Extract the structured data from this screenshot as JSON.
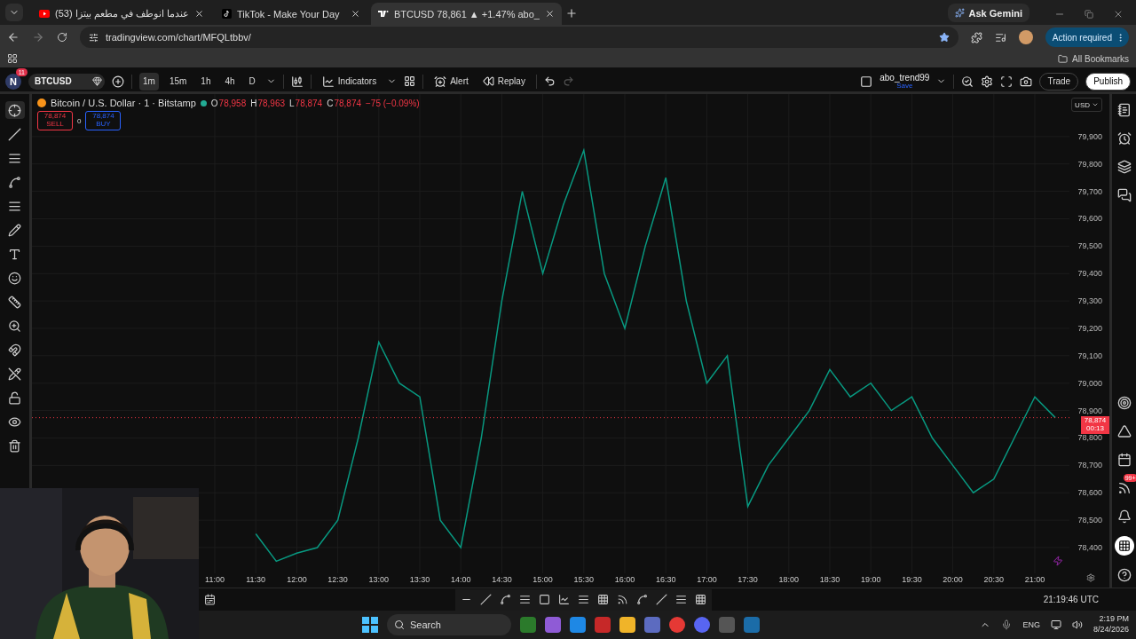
{
  "browser": {
    "tabs": [
      {
        "title": "عندما انوطف في مطعم بيتزا (53)",
        "kind": "video",
        "selected": false
      },
      {
        "title": "TikTok - Make Your Day",
        "kind": "music",
        "selected": false
      },
      {
        "title": "BTCUSD 78,861 ▲ +1.47% abo_",
        "kind": "chart",
        "selected": true
      }
    ],
    "ask_gemini": "Ask Gemini",
    "url": "tradingview.com/chart/MFQLtbbv/",
    "action_required": "Action required",
    "bookmarks": "All Bookmarks"
  },
  "toolbar": {
    "avatar": "N",
    "avatar_badge": "11",
    "symbol": "BTCUSD",
    "intervals": [
      {
        "label": "1m",
        "selected": true
      },
      {
        "label": "15m",
        "selected": false
      },
      {
        "label": "1h",
        "selected": false
      },
      {
        "label": "4h",
        "selected": false
      },
      {
        "label": "D",
        "selected": false
      }
    ],
    "indicators": "Indicators",
    "alert": "Alert",
    "replay": "Replay",
    "layout_name": "abo_trend99",
    "save": "Save",
    "trade": "Trade",
    "publish": "Publish"
  },
  "legend": {
    "title": "Bitcoin / U.S. Dollar · 1 · Bitstamp",
    "ohlc": [
      {
        "label": "O",
        "value": "78,958"
      },
      {
        "label": "H",
        "value": "78,963"
      },
      {
        "label": "L",
        "value": "78,874"
      },
      {
        "label": "C",
        "value": "78,874"
      }
    ],
    "change": "−75 (−0.09%)",
    "sell_price": "78,874",
    "sell": "SELL",
    "spread": "0",
    "buy_price": "78,874",
    "buy": "BUY"
  },
  "chart": {
    "currency": "USD",
    "price_tag": "78,874",
    "countdown": "00:13",
    "clock": "21:19:46 UTC",
    "chart_data": {
      "type": "line",
      "categories": [
        "11:00",
        null,
        "11:30",
        null,
        "12:00",
        null,
        "12:30",
        null,
        "13:00",
        null,
        "13:30",
        null,
        "14:00",
        null,
        "14:30",
        null,
        "15:00",
        null,
        "15:30",
        null,
        "16:00",
        null,
        "16:30",
        null,
        "17:00",
        null,
        "17:30",
        null,
        "18:00",
        null,
        "18:30",
        null,
        "19:00",
        null,
        "19:30",
        null,
        "20:00",
        null,
        "20:30",
        null,
        "21:00",
        null
      ],
      "series": [
        {
          "color": "#089981",
          "values": [
            null,
            null,
            78450,
            78350,
            78380,
            78400,
            78500,
            78800,
            79150,
            79000,
            78950,
            78500,
            78400,
            78800,
            79300,
            79700,
            79400,
            79650,
            79850,
            79400,
            79200,
            79500,
            79750,
            79300,
            79000,
            79100,
            78550,
            78700,
            78800,
            78900,
            79050,
            78950,
            79000,
            78900,
            78950,
            78800,
            78700,
            78600,
            78650,
            78800,
            78950,
            78874
          ]
        }
      ],
      "ylim": [
        78306,
        80055
      ],
      "grid": true,
      "ref_lines": [
        {
          "axis": "y",
          "value": 78874,
          "color": "#f23645"
        }
      ],
      "yticks": [
        {
          "value": 79900,
          "label": "79,900"
        },
        {
          "value": 79800,
          "label": "79,800"
        },
        {
          "value": 79700,
          "label": "79,700"
        },
        {
          "value": 79600,
          "label": "79,600"
        },
        {
          "value": 79500,
          "label": "79,500"
        },
        {
          "value": 79400,
          "label": "79,400"
        },
        {
          "value": 79300,
          "label": "79,300"
        },
        {
          "value": 79200,
          "label": "79,200"
        },
        {
          "value": 79100,
          "label": "79,100"
        },
        {
          "value": 79000,
          "label": "79,000"
        },
        {
          "value": 78900,
          "label": "78,900"
        },
        {
          "value": 78800,
          "label": "78,800"
        },
        {
          "value": 78700,
          "label": "78,700"
        },
        {
          "value": 78600,
          "label": "78,600"
        },
        {
          "value": 78500,
          "label": "78,500"
        },
        {
          "value": 78400,
          "label": "78,400"
        }
      ]
    }
  },
  "sidebar": {
    "news_badge": "99+"
  },
  "taskbar": {
    "search": "Search",
    "language": "ENG",
    "time": "2:19 PM",
    "date": "8/24/2026"
  }
}
